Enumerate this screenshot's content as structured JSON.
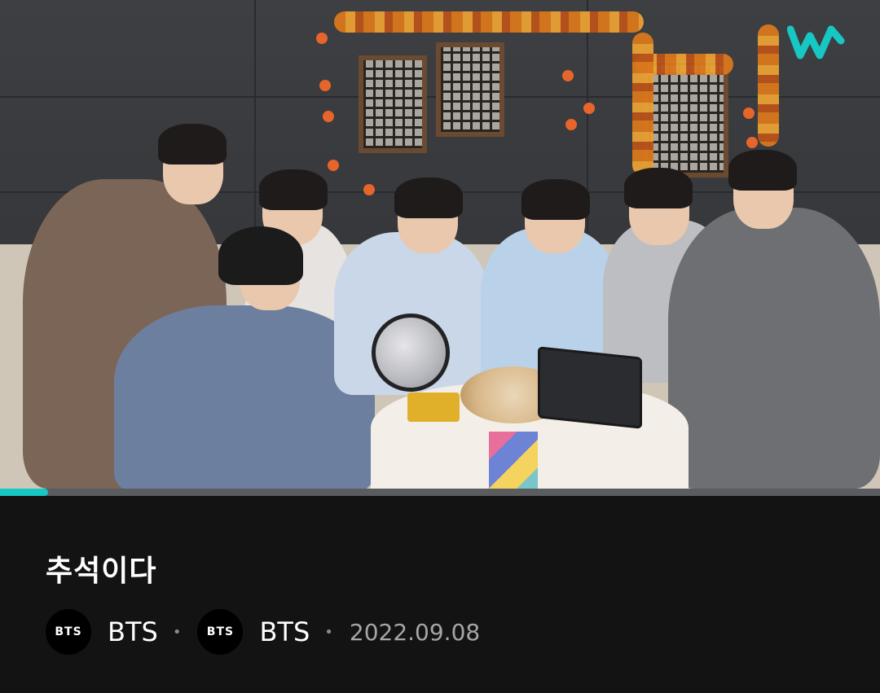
{
  "player": {
    "progress_fraction": 0.055,
    "accent": "#16c7c3",
    "logo_icon": "weverse-w-logo"
  },
  "post": {
    "title": "추석이다",
    "artist_1": {
      "avatar_text": "BTS",
      "name": "BTS"
    },
    "artist_2": {
      "avatar_text": "BTS",
      "name": "BTS"
    },
    "separator": "•",
    "date": "2022.09.08"
  },
  "colors": {
    "background": "#131313",
    "title": "#ffffff",
    "date": "#a6a6a6"
  }
}
